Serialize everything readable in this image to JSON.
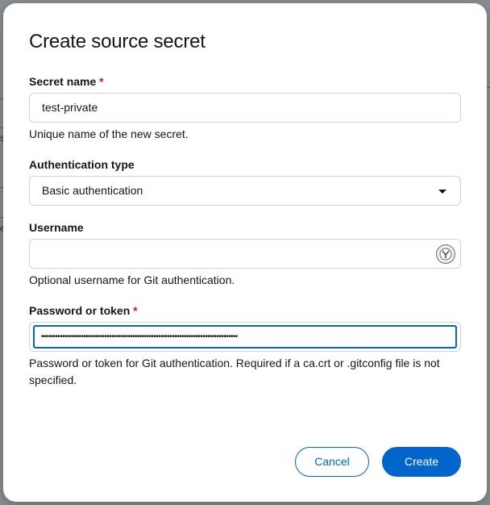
{
  "modal": {
    "title": "Create source secret",
    "required_marker": "*",
    "secret_name": {
      "label": "Secret name",
      "value": "test-private",
      "helper": "Unique name of the new secret."
    },
    "auth_type": {
      "label": "Authentication type",
      "selected": "Basic authentication"
    },
    "username": {
      "label": "Username",
      "value": "",
      "helper": "Optional username for Git authentication.",
      "icon": "password-manager-icon"
    },
    "password": {
      "label": "Password or token",
      "value": "••••••••••••••••••••••••••••••••••••••••••••••••••••••••••••••••••••••••••••••••••••",
      "helper": "Password or token for Git authentication. Required if a ca.crt or .gitconfig file is not specified."
    },
    "buttons": {
      "cancel": "Cancel",
      "create": "Create"
    }
  },
  "background": {
    "edge_glyphs": [
      "s",
      "e"
    ]
  },
  "colors": {
    "primary": "#0066cc",
    "required": "#c9190b",
    "border": "#d2d2d2"
  }
}
